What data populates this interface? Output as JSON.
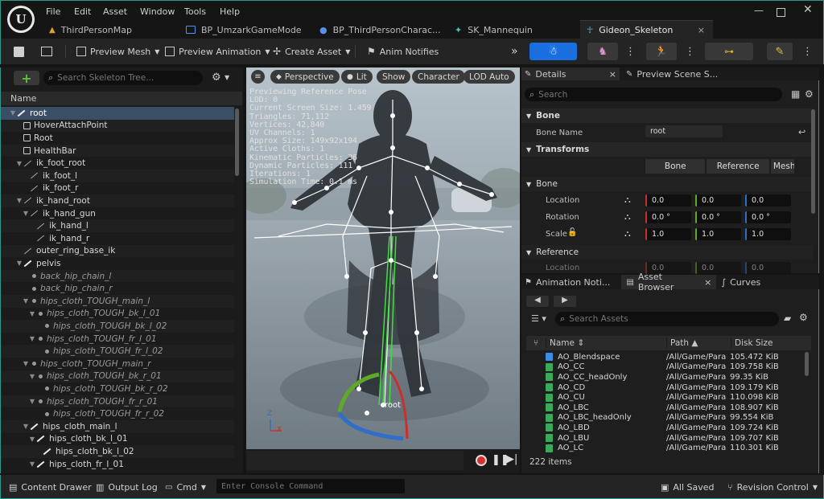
{
  "menu": [
    "File",
    "Edit",
    "Asset",
    "Window",
    "Tools",
    "Help"
  ],
  "tabs": [
    {
      "label": "ThirdPersonMap"
    },
    {
      "label": "BP_UmzarkGameMode"
    },
    {
      "label": "BP_ThirdPersonCharac..."
    },
    {
      "label": "SK_Mannequin"
    },
    {
      "label": "Gideon_Skeleton",
      "close": "×"
    }
  ],
  "toolbar": {
    "preview_mesh": "Preview Mesh",
    "preview_animation": "Preview Animation",
    "create_asset": "Create Asset",
    "anim_notifies": "Anim Notifies"
  },
  "skeleton_tree": {
    "search_placeholder": "Search Skeleton Tree...",
    "column_name": "Name",
    "items": [
      {
        "label": "root",
        "depth": 0,
        "type": "bone",
        "selected": true
      },
      {
        "label": "HoverAttachPoint",
        "depth": 1,
        "type": "socket"
      },
      {
        "label": "Root",
        "depth": 1,
        "type": "socket"
      },
      {
        "label": "HealthBar",
        "depth": 1,
        "type": "socket"
      },
      {
        "label": "ik_foot_root",
        "depth": 1,
        "type": "ik"
      },
      {
        "label": "ik_foot_l",
        "depth": 2,
        "type": "ik"
      },
      {
        "label": "ik_foot_r",
        "depth": 2,
        "type": "ik"
      },
      {
        "label": "ik_hand_root",
        "depth": 1,
        "type": "ik"
      },
      {
        "label": "ik_hand_gun",
        "depth": 2,
        "type": "ik"
      },
      {
        "label": "ik_hand_l",
        "depth": 3,
        "type": "ik"
      },
      {
        "label": "ik_hand_r",
        "depth": 3,
        "type": "ik"
      },
      {
        "label": "outer_ring_base_ik",
        "depth": 1,
        "type": "ik"
      },
      {
        "label": "pelvis",
        "depth": 1,
        "type": "bone"
      },
      {
        "label": "back_hip_chain_l",
        "depth": 2,
        "type": "dim"
      },
      {
        "label": "back_hip_chain_r",
        "depth": 2,
        "type": "dim"
      },
      {
        "label": "hips_cloth_TOUGH_main_l",
        "depth": 2,
        "type": "dim"
      },
      {
        "label": "hips_cloth_TOUGH_bk_l_01",
        "depth": 3,
        "type": "dim"
      },
      {
        "label": "hips_cloth_TOUGH_bk_l_02",
        "depth": 4,
        "type": "dim"
      },
      {
        "label": "hips_cloth_TOUGH_fr_l_01",
        "depth": 3,
        "type": "dim"
      },
      {
        "label": "hips_cloth_TOUGH_fr_l_02",
        "depth": 4,
        "type": "dim"
      },
      {
        "label": "hips_cloth_TOUGH_main_r",
        "depth": 2,
        "type": "dim"
      },
      {
        "label": "hips_cloth_TOUGH_bk_r_01",
        "depth": 3,
        "type": "dim"
      },
      {
        "label": "hips_cloth_TOUGH_bk_r_02",
        "depth": 4,
        "type": "dim"
      },
      {
        "label": "hips_cloth_TOUGH_fr_r_01",
        "depth": 3,
        "type": "dim"
      },
      {
        "label": "hips_cloth_TOUGH_fr_r_02",
        "depth": 4,
        "type": "dim"
      },
      {
        "label": "hips_cloth_main_l",
        "depth": 2,
        "type": "bone"
      },
      {
        "label": "hips_cloth_bk_l_01",
        "depth": 3,
        "type": "bone"
      },
      {
        "label": "hips_cloth_bk_l_02",
        "depth": 4,
        "type": "bone"
      },
      {
        "label": "hips_cloth_fr_l_01",
        "depth": 3,
        "type": "bone"
      }
    ]
  },
  "viewport": {
    "buttons": {
      "perspective": "Perspective",
      "lit": "Lit",
      "show": "Show",
      "character": "Character",
      "lod": "LOD Auto"
    },
    "stats": [
      "Previewing Reference Pose",
      "LOD: 0",
      "Current Screen Size: 1.459",
      "Triangles: 71,112",
      "Vertices: 42,840",
      "UV Channels: 1",
      "Approx Size: 149x92x194",
      "Active Cloths: 1",
      "Kinematic Particles: 36",
      "Dynamic Particles: 111",
      "Iterations: 1",
      "Simulation Time: 0.1 ms"
    ],
    "root_label": "root",
    "axis_x": "X",
    "axis_z": "Z"
  },
  "details": {
    "tab_label": "Details",
    "tab_close": "×",
    "tab2_label": "Preview Scene S...",
    "search_placeholder": "Search",
    "bone_section": "Bone",
    "bone_name_label": "Bone Name",
    "bone_name_value": "root",
    "transforms_section": "Transforms",
    "seg_bone": "Bone",
    "seg_reference": "Reference",
    "seg_mesh": "Mesh",
    "bone_sub": "Bone",
    "location_label": "Location",
    "rotation_label": "Rotation",
    "scale_label": "Scale",
    "location": [
      "0.0",
      "0.0",
      "0.0"
    ],
    "rotation": [
      "0.0 °",
      "0.0 °",
      "0.0 °"
    ],
    "scale": [
      "1.0",
      "1.0",
      "1.0"
    ],
    "reference_sub": "Reference",
    "ref_location_label": "Location",
    "ref_location": [
      "0.0",
      "0.0",
      "0.0"
    ]
  },
  "asset_browser": {
    "tab_notifies": "Animation Noti...",
    "tab_browser": "Asset Browser",
    "tab_close": "×",
    "tab_curves": "Curves",
    "search_placeholder": "Search Assets",
    "col_name": "Name",
    "col_path": "Path",
    "col_size": "Disk Size",
    "rows": [
      {
        "name": "AO_Blendspace",
        "path": "/All/Game/Para",
        "size": "105.472 KiB",
        "kind": "blend"
      },
      {
        "name": "AO_CC",
        "path": "/All/Game/Para",
        "size": "109.758 KiB",
        "kind": "anim"
      },
      {
        "name": "AO_CC_headOnly",
        "path": "/All/Game/Para",
        "size": "99.35 KiB",
        "kind": "anim"
      },
      {
        "name": "AO_CD",
        "path": "/All/Game/Para",
        "size": "109.179 KiB",
        "kind": "anim"
      },
      {
        "name": "AO_CU",
        "path": "/All/Game/Para",
        "size": "110.098 KiB",
        "kind": "anim"
      },
      {
        "name": "AO_LBC",
        "path": "/All/Game/Para",
        "size": "108.907 KiB",
        "kind": "anim"
      },
      {
        "name": "AO_LBC_headOnly",
        "path": "/All/Game/Para",
        "size": "99.554 KiB",
        "kind": "anim"
      },
      {
        "name": "AO_LBD",
        "path": "/All/Game/Para",
        "size": "109.724 KiB",
        "kind": "anim"
      },
      {
        "name": "AO_LBU",
        "path": "/All/Game/Para",
        "size": "109.707 KiB",
        "kind": "anim"
      },
      {
        "name": "AO_LC",
        "path": "/All/Game/Para",
        "size": "110.301 KiB",
        "kind": "anim"
      }
    ],
    "items_count": "222 items"
  },
  "statusbar": {
    "content_drawer": "Content Drawer",
    "output_log": "Output Log",
    "cmd": "Cmd",
    "console_placeholder": "Enter Console Command",
    "all_saved": "All Saved",
    "revision_control": "Revision Control"
  },
  "colors": {
    "accent": "#1a6fe0",
    "teal_border": "#2a9a8a",
    "selection": "#3a4e66"
  }
}
